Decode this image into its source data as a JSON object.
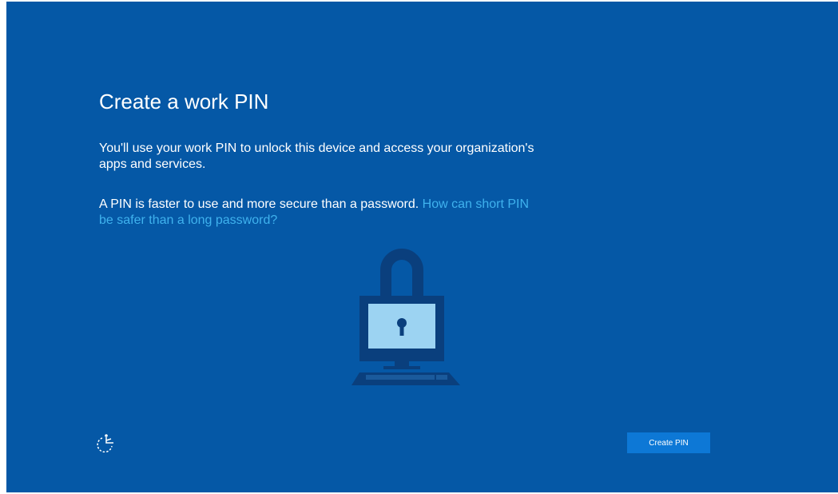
{
  "page": {
    "title": "Create a work PIN",
    "description": "You'll use your work PIN to unlock this device and access your organization's apps and services.",
    "secondary_text": "A PIN is faster to use and more secure than a password.",
    "help_link": "How can short PIN be safer than a long password?"
  },
  "footer": {
    "ease_of_access_icon": "ease-of-access-icon",
    "create_pin_label": "Create PIN"
  },
  "illustration": {
    "icon": "lock-computer-icon"
  },
  "colors": {
    "background": "#0558a6",
    "text": "#ffffff",
    "link": "#3fb2ee",
    "button": "#0d78d6",
    "illustration_dark": "#0a3f7d",
    "screen_light": "#9cd3f2"
  }
}
